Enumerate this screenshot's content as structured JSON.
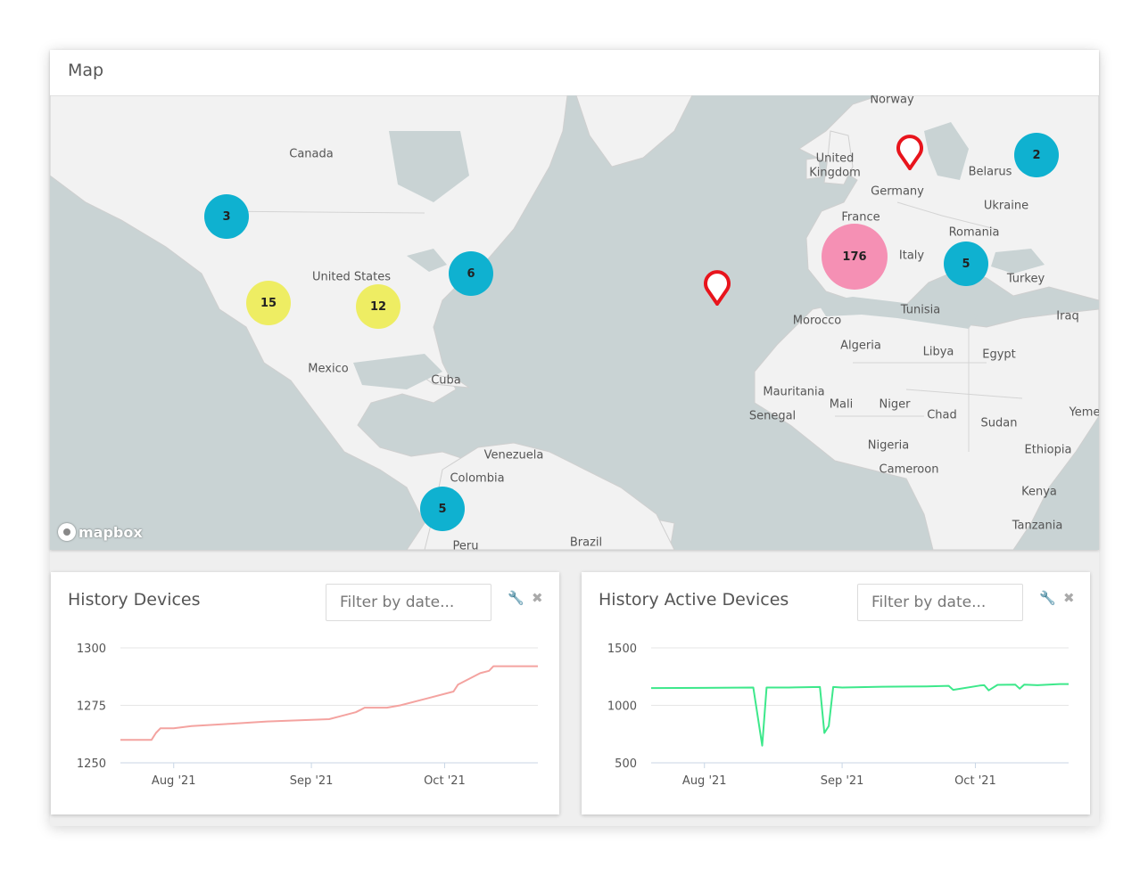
{
  "map_panel": {
    "title": "Map",
    "attribution": "mapbox",
    "labels": [
      {
        "name": "canada",
        "text": "Canada"
      },
      {
        "name": "united-states",
        "text": "United States"
      },
      {
        "name": "mexico",
        "text": "Mexico"
      },
      {
        "name": "cuba",
        "text": "Cuba"
      },
      {
        "name": "venezuela",
        "text": "Venezuela"
      },
      {
        "name": "colombia",
        "text": "Colombia"
      },
      {
        "name": "brazil",
        "text": "Brazil"
      },
      {
        "name": "peru",
        "text": "Peru"
      },
      {
        "name": "norway",
        "text": "Norway"
      },
      {
        "name": "united",
        "text": "United"
      },
      {
        "name": "kingdom",
        "text": "Kingdom"
      },
      {
        "name": "germany",
        "text": "Germany"
      },
      {
        "name": "belarus",
        "text": "Belarus"
      },
      {
        "name": "ukraine",
        "text": "Ukraine"
      },
      {
        "name": "france",
        "text": "France"
      },
      {
        "name": "romania",
        "text": "Romania"
      },
      {
        "name": "italy",
        "text": "Italy"
      },
      {
        "name": "turkey",
        "text": "Turkey"
      },
      {
        "name": "tunisia",
        "text": "Tunisia"
      },
      {
        "name": "iraq",
        "text": "Iraq"
      },
      {
        "name": "morocco",
        "text": "Morocco"
      },
      {
        "name": "algeria",
        "text": "Algeria"
      },
      {
        "name": "libya",
        "text": "Libya"
      },
      {
        "name": "egypt",
        "text": "Egypt"
      },
      {
        "name": "mauritania",
        "text": "Mauritania"
      },
      {
        "name": "mali",
        "text": "Mali"
      },
      {
        "name": "niger",
        "text": "Niger"
      },
      {
        "name": "senegal",
        "text": "Senegal"
      },
      {
        "name": "chad",
        "text": "Chad"
      },
      {
        "name": "sudan",
        "text": "Sudan"
      },
      {
        "name": "yemen",
        "text": "Yeme"
      },
      {
        "name": "nigeria",
        "text": "Nigeria"
      },
      {
        "name": "ethiopia",
        "text": "Ethiopia"
      },
      {
        "name": "cameroon",
        "text": "Cameroon"
      },
      {
        "name": "kenya",
        "text": "Kenya"
      },
      {
        "name": "tanzania",
        "text": "Tanzania"
      }
    ],
    "clusters": [
      {
        "count": "3",
        "color": "#0fb1d0"
      },
      {
        "count": "15",
        "color": "#eeed63"
      },
      {
        "count": "12",
        "color": "#eeed63"
      },
      {
        "count": "6",
        "color": "#0fb1d0"
      },
      {
        "count": "5",
        "color": "#0fb1d0"
      },
      {
        "count": "176",
        "color": "#f590b4"
      },
      {
        "count": "5",
        "color": "#0fb1d0"
      },
      {
        "count": "2",
        "color": "#0fb1d0"
      }
    ],
    "marker_color": "#e8141c"
  },
  "history_devices": {
    "title": "History Devices",
    "filter_placeholder": "Filter by date...",
    "chart_data": {
      "type": "line",
      "title": "History Devices",
      "xlabel": "",
      "ylabel": "",
      "x_ticks": [
        "Aug '21",
        "Sep '21",
        "Oct '21"
      ],
      "y_ticks": [
        "1300",
        "1275",
        "1250"
      ],
      "ylim": [
        1250,
        1300
      ],
      "xlim": [
        "2021-07-20",
        "2021-10-22"
      ],
      "grid": true,
      "color": "#f4a3a0",
      "series": [
        {
          "x": [
            "2021-07-20",
            "2021-07-27",
            "2021-07-28",
            "2021-07-29",
            "2021-08-01",
            "2021-08-05",
            "2021-08-14",
            "2021-08-22",
            "2021-09-05",
            "2021-09-11",
            "2021-09-12",
            "2021-09-13",
            "2021-09-18",
            "2021-09-21",
            "2021-09-27",
            "2021-10-03",
            "2021-10-04",
            "2021-10-06",
            "2021-10-09",
            "2021-10-11",
            "2021-10-12",
            "2021-10-22"
          ],
          "values": [
            1260,
            1260,
            1263,
            1265,
            1265,
            1266,
            1267,
            1268,
            1269,
            1272,
            1273,
            1274,
            1274,
            1275,
            1278,
            1281,
            1284,
            1286,
            1289,
            1290,
            1292,
            1292
          ]
        }
      ]
    }
  },
  "history_active_devices": {
    "title": "History Active Devices",
    "filter_placeholder": "Filter by date...",
    "chart_data": {
      "type": "line",
      "title": "History Active Devices",
      "xlabel": "",
      "ylabel": "",
      "x_ticks": [
        "Aug '21",
        "Sep '21",
        "Oct '21"
      ],
      "y_ticks": [
        "1500",
        "1000",
        "500"
      ],
      "ylim": [
        500,
        1500
      ],
      "xlim": [
        "2021-07-20",
        "2021-10-22"
      ],
      "grid": true,
      "color": "#3de88b",
      "series": [
        {
          "x": [
            "2021-07-20",
            "2021-08-01",
            "2021-08-12",
            "2021-08-14",
            "2021-08-15",
            "2021-08-16",
            "2021-08-20",
            "2021-08-27",
            "2021-08-28",
            "2021-08-29",
            "2021-08-30",
            "2021-09-01",
            "2021-09-10",
            "2021-09-20",
            "2021-09-25",
            "2021-09-26",
            "2021-10-02",
            "2021-10-03",
            "2021-10-04",
            "2021-10-06",
            "2021-10-10",
            "2021-10-11",
            "2021-10-12",
            "2021-10-15",
            "2021-10-20",
            "2021-10-22"
          ],
          "values": [
            1150,
            1152,
            1155,
            650,
            1155,
            1155,
            1155,
            1160,
            760,
            820,
            1160,
            1155,
            1162,
            1165,
            1170,
            1135,
            1172,
            1175,
            1130,
            1178,
            1180,
            1145,
            1180,
            1175,
            1185,
            1185
          ]
        }
      ]
    }
  }
}
